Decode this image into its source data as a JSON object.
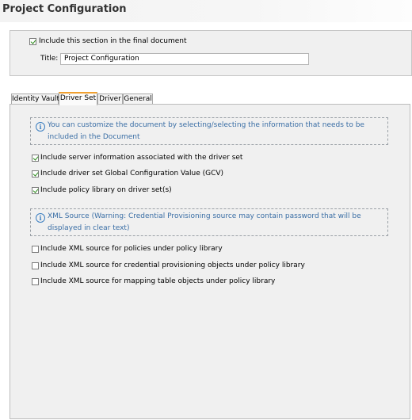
{
  "page": {
    "title": "Project Configuration"
  },
  "section": {
    "include_label": "Include this section in the final document",
    "include_checked": true,
    "title_label": "Title:",
    "title_value": "Project Configuration"
  },
  "tabs": [
    {
      "label": "Identity Vault",
      "active": false
    },
    {
      "label": "Driver Set",
      "active": true
    },
    {
      "label": "Driver",
      "active": false
    },
    {
      "label": "General",
      "active": false
    }
  ],
  "driver_set": {
    "info_text": "You can customize the document by selecting/selecting the information that needs to be included in the Document",
    "options": [
      {
        "label": "Include server information associated with the driver set",
        "checked": true
      },
      {
        "label": "Include driver set Global Configuration Value (GCV)",
        "checked": true
      },
      {
        "label": "Include policy library on driver set(s)",
        "checked": true
      }
    ],
    "xml_warning": "XML Source (Warning: Credential Provisioning source may contain password that will be displayed in clear text)",
    "xml_options": [
      {
        "label": "Include XML source for policies under policy library",
        "checked": false
      },
      {
        "label": "Include XML source for credential provisioning objects under policy library",
        "checked": false
      },
      {
        "label": "Include XML source for mapping table objects under policy library",
        "checked": false
      }
    ]
  }
}
